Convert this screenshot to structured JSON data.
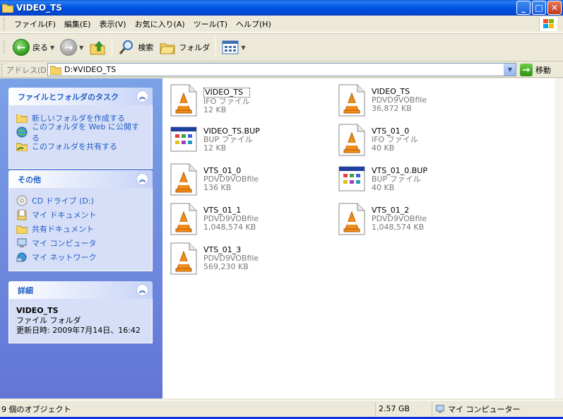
{
  "window": {
    "title": "VIDEO_TS"
  },
  "menu": {
    "items": [
      "ファイル(F)",
      "編集(E)",
      "表示(V)",
      "お気に入り(A)",
      "ツール(T)",
      "ヘルプ(H)"
    ]
  },
  "toolbar": {
    "back_label": "戻る",
    "search_label": "検索",
    "folders_label": "フォルダ"
  },
  "address": {
    "label": "アドレス(D)",
    "value": "D:¥VIDEO_TS",
    "go_label": "移動"
  },
  "tasks_panel": {
    "title": "ファイルとフォルダのタスク",
    "items": [
      "新しいフォルダを作成する",
      "このフォルダを Web に公開する",
      "このフォルダを共有する"
    ]
  },
  "other_panel": {
    "title": "その他",
    "items": [
      "CD ドライブ (D:)",
      "マイ ドキュメント",
      "共有ドキュメント",
      "マイ コンピュータ",
      "マイ ネットワーク"
    ]
  },
  "details_panel": {
    "title": "詳細",
    "name": "VIDEO_TS",
    "type": "ファイル フォルダ",
    "modified": "更新日時: 2009年7月14日、16:42"
  },
  "files": [
    {
      "name": "VIDEO_TS",
      "type": "IFO ファイル",
      "size": "12 KB",
      "icon": "vlc-cone-icon"
    },
    {
      "name": "VIDEO_TS",
      "type": "PDVD9VOBfile",
      "size": "36,872 KB",
      "icon": "vlc-cone-icon"
    },
    {
      "name": "VIDEO_TS.BUP",
      "type": "BUP ファイル",
      "size": "12 KB",
      "icon": "generic-window-icon"
    },
    {
      "name": "VTS_01_0",
      "type": "IFO ファイル",
      "size": "40 KB",
      "icon": "vlc-cone-icon"
    },
    {
      "name": "VTS_01_0",
      "type": "PDVD9VOBfile",
      "size": "136 KB",
      "icon": "vlc-cone-icon"
    },
    {
      "name": "VTS_01_0.BUP",
      "type": "BUP ファイル",
      "size": "40 KB",
      "icon": "generic-window-icon"
    },
    {
      "name": "VTS_01_1",
      "type": "PDVD9VOBfile",
      "size": "1,048,574 KB",
      "icon": "vlc-cone-icon"
    },
    {
      "name": "VTS_01_2",
      "type": "PDVD9VOBfile",
      "size": "1,048,574 KB",
      "icon": "vlc-cone-icon"
    },
    {
      "name": "VTS_01_3",
      "type": "PDVD9VOBfile",
      "size": "569,230 KB",
      "icon": "vlc-cone-icon"
    }
  ],
  "status": {
    "objects": "9 個のオブジェクト",
    "size": "2.57 GB",
    "location": "マイ コンピューター"
  }
}
